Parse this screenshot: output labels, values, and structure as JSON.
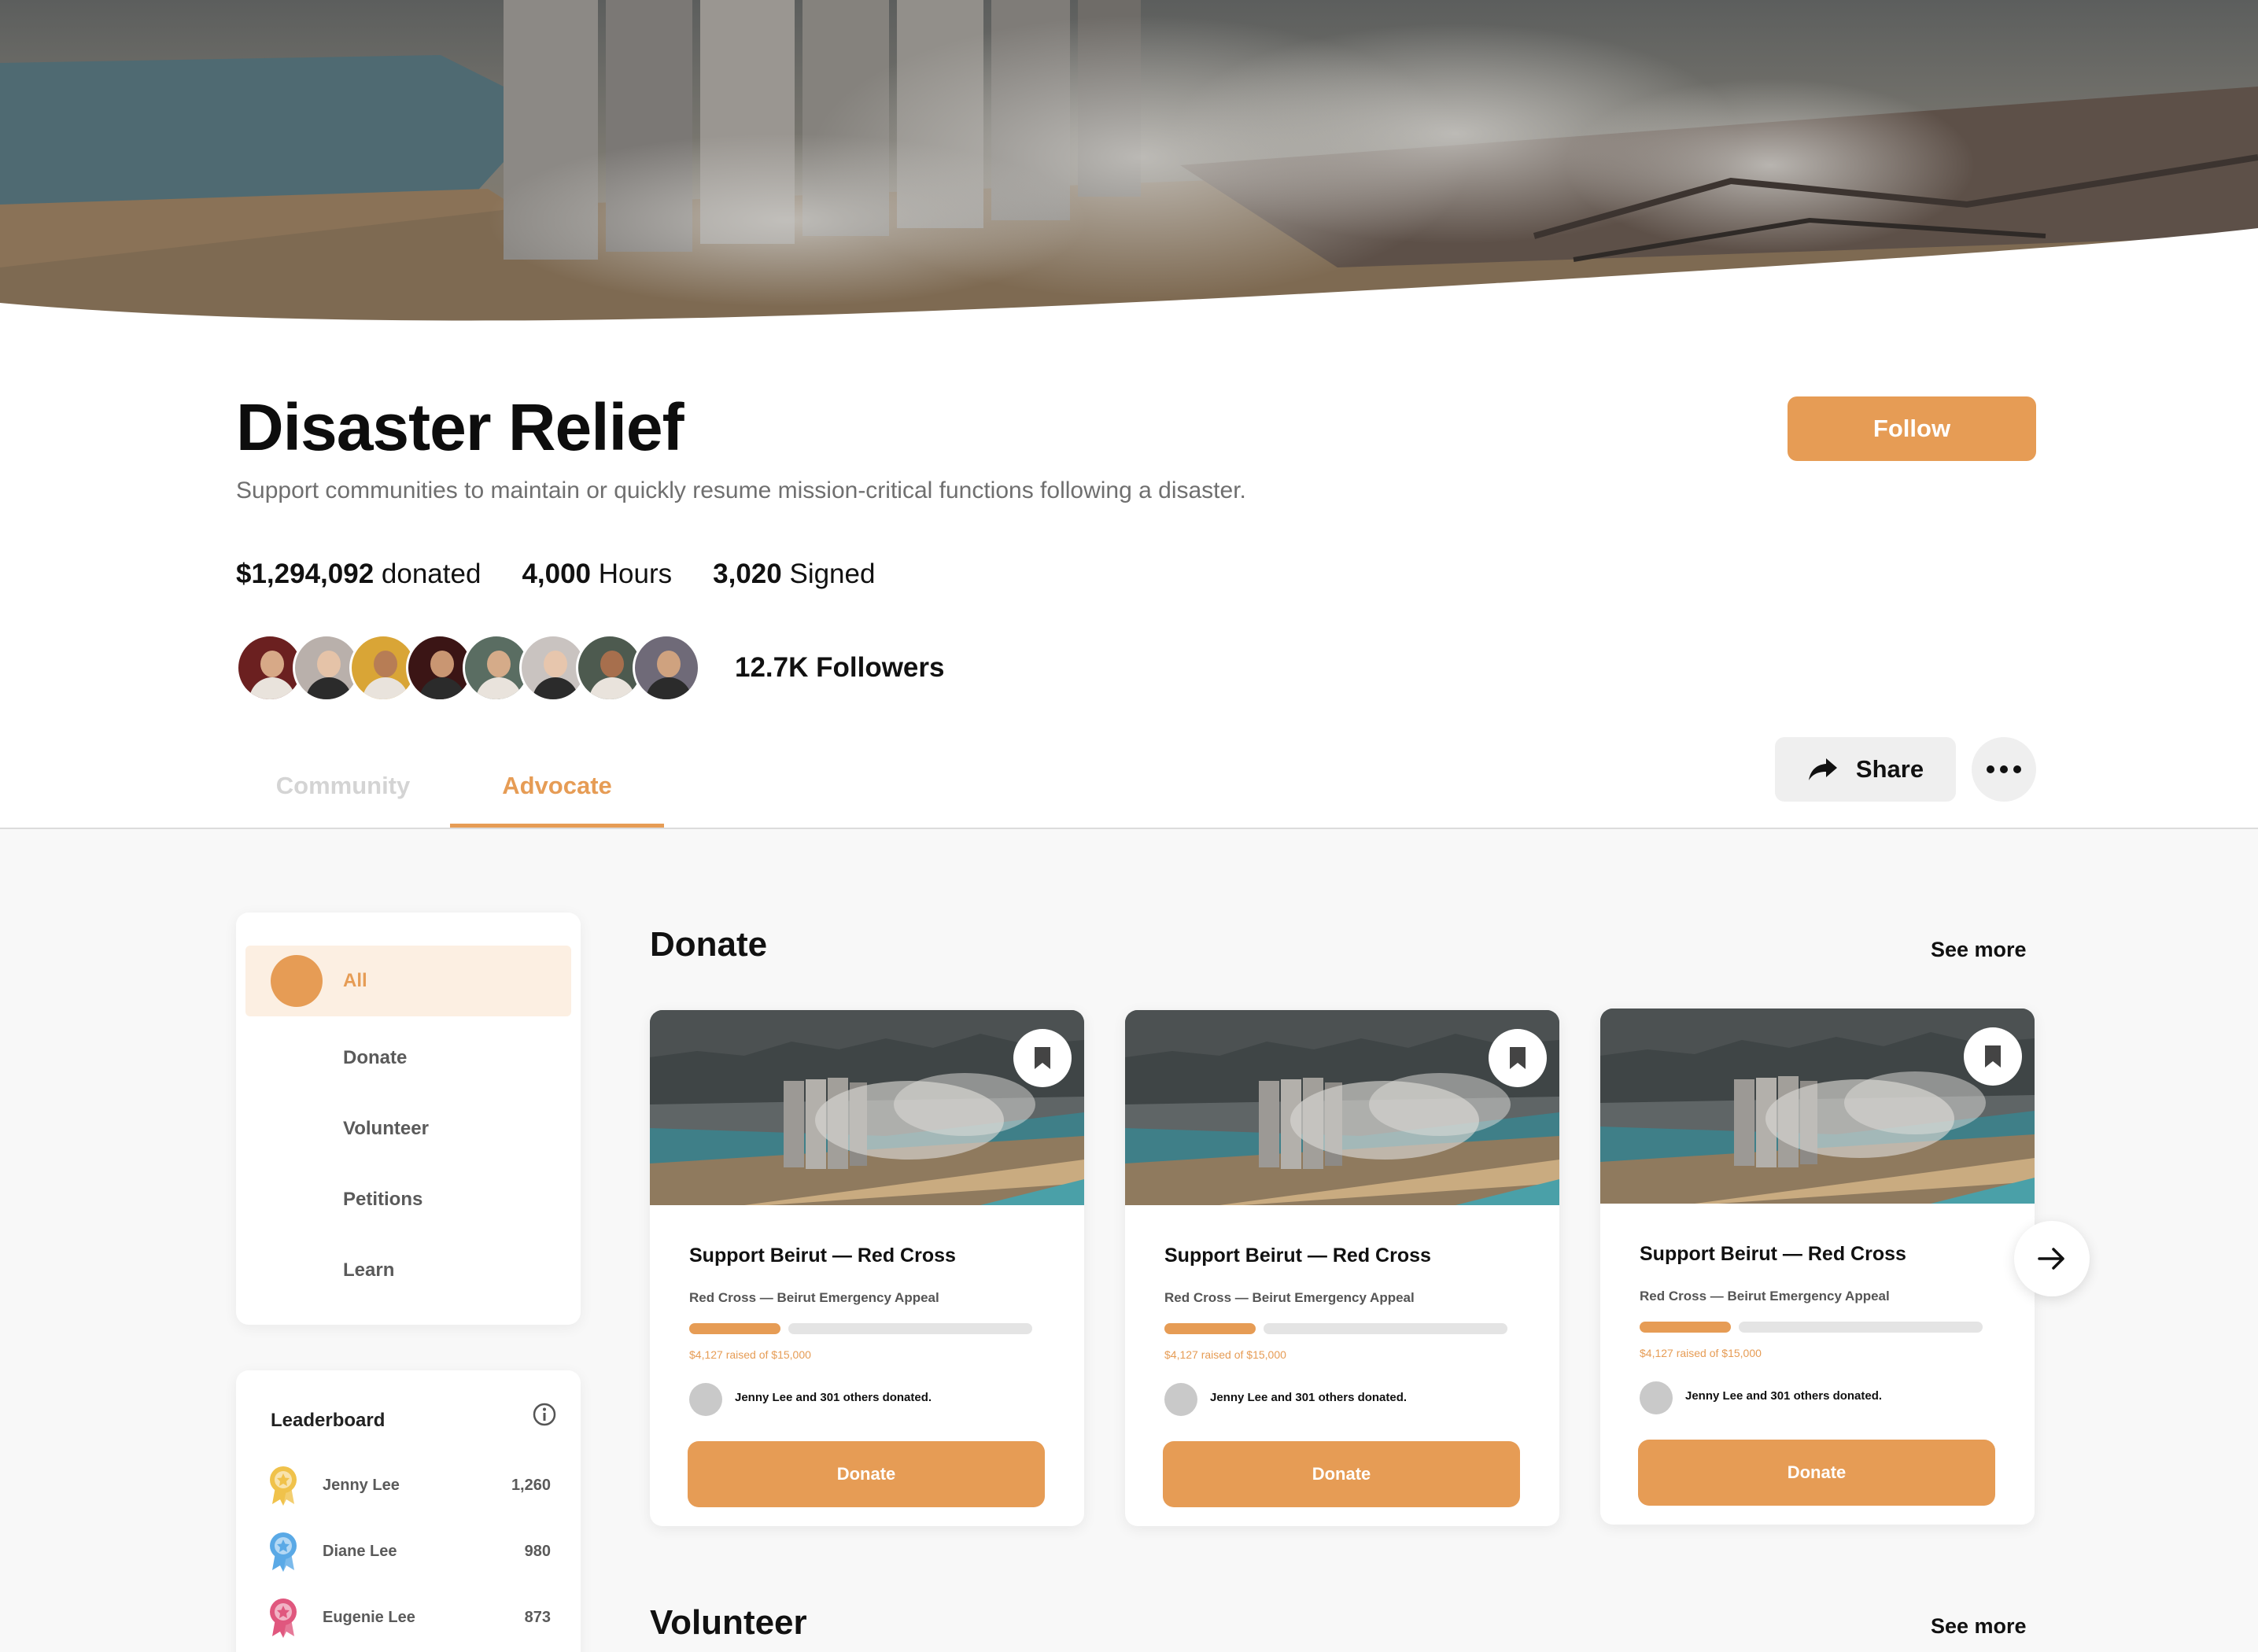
{
  "header": {
    "title": "Disaster Relief",
    "subtitle": "Support communities to maintain or quickly resume mission-critical functions following a disaster.",
    "follow_label": "Follow"
  },
  "stats": [
    {
      "value": "$1,294,092",
      "label": "donated"
    },
    {
      "value": "4,000",
      "label": "Hours"
    },
    {
      "value": "3,020",
      "label": "Signed"
    }
  ],
  "followers": {
    "label": "12.7K Followers",
    "avatar_colors": [
      "#6b2020",
      "#b9b0ab",
      "#d9a536",
      "#3b1515",
      "#5a6d62",
      "#c9c3c0",
      "#4d5a4f",
      "#6f6a78"
    ]
  },
  "tabs": [
    {
      "label": "Community",
      "active": false
    },
    {
      "label": "Advocate",
      "active": true
    }
  ],
  "actions": {
    "share_label": "Share",
    "share_icon": "share-arrow-icon",
    "more_icon": "more-dots-icon"
  },
  "filters": [
    {
      "label": "All",
      "active": true
    },
    {
      "label": "Donate",
      "active": false
    },
    {
      "label": "Volunteer",
      "active": false
    },
    {
      "label": "Petitions",
      "active": false
    },
    {
      "label": "Learn",
      "active": false
    }
  ],
  "leaderboard": {
    "title": "Leaderboard",
    "rows": [
      {
        "name": "Jenny Lee",
        "score": "1,260",
        "badge_color": "#f0c24b"
      },
      {
        "name": "Diane Lee",
        "score": "980",
        "badge_color": "#5aa9e6"
      },
      {
        "name": "Eugenie Lee",
        "score": "873",
        "badge_color": "#e0577e"
      }
    ]
  },
  "donate_section": {
    "title": "Donate",
    "see_more": "See more",
    "cards": [
      {
        "title": "Support Beirut — Red Cross",
        "org": "Red Cross  — Beirut Emergency Appeal",
        "raised_text": "$4,127 raised of $15,000",
        "progress": 0.275,
        "donors_text": "Jenny Lee and 301 others donated.",
        "button_label": "Donate"
      },
      {
        "title": "Support Beirut — Red Cross",
        "org": "Red Cross  — Beirut Emergency Appeal",
        "raised_text": "$4,127 raised of $15,000",
        "progress": 0.275,
        "donors_text": "Jenny Lee and 301 others donated.",
        "button_label": "Donate"
      },
      {
        "title": "Support Beirut — Red Cross",
        "org": "Red Cross  — Beirut Emergency Appeal",
        "raised_text": "$4,127 raised of $15,000",
        "progress": 0.275,
        "donors_text": "Jenny Lee and 301 others donated.",
        "button_label": "Donate"
      }
    ]
  },
  "volunteer_section": {
    "title": "Volunteer",
    "see_more": "See more"
  },
  "colors": {
    "accent": "#e69c55",
    "accent_light": "#fcefe2",
    "page_bg": "#f8f8f8"
  }
}
